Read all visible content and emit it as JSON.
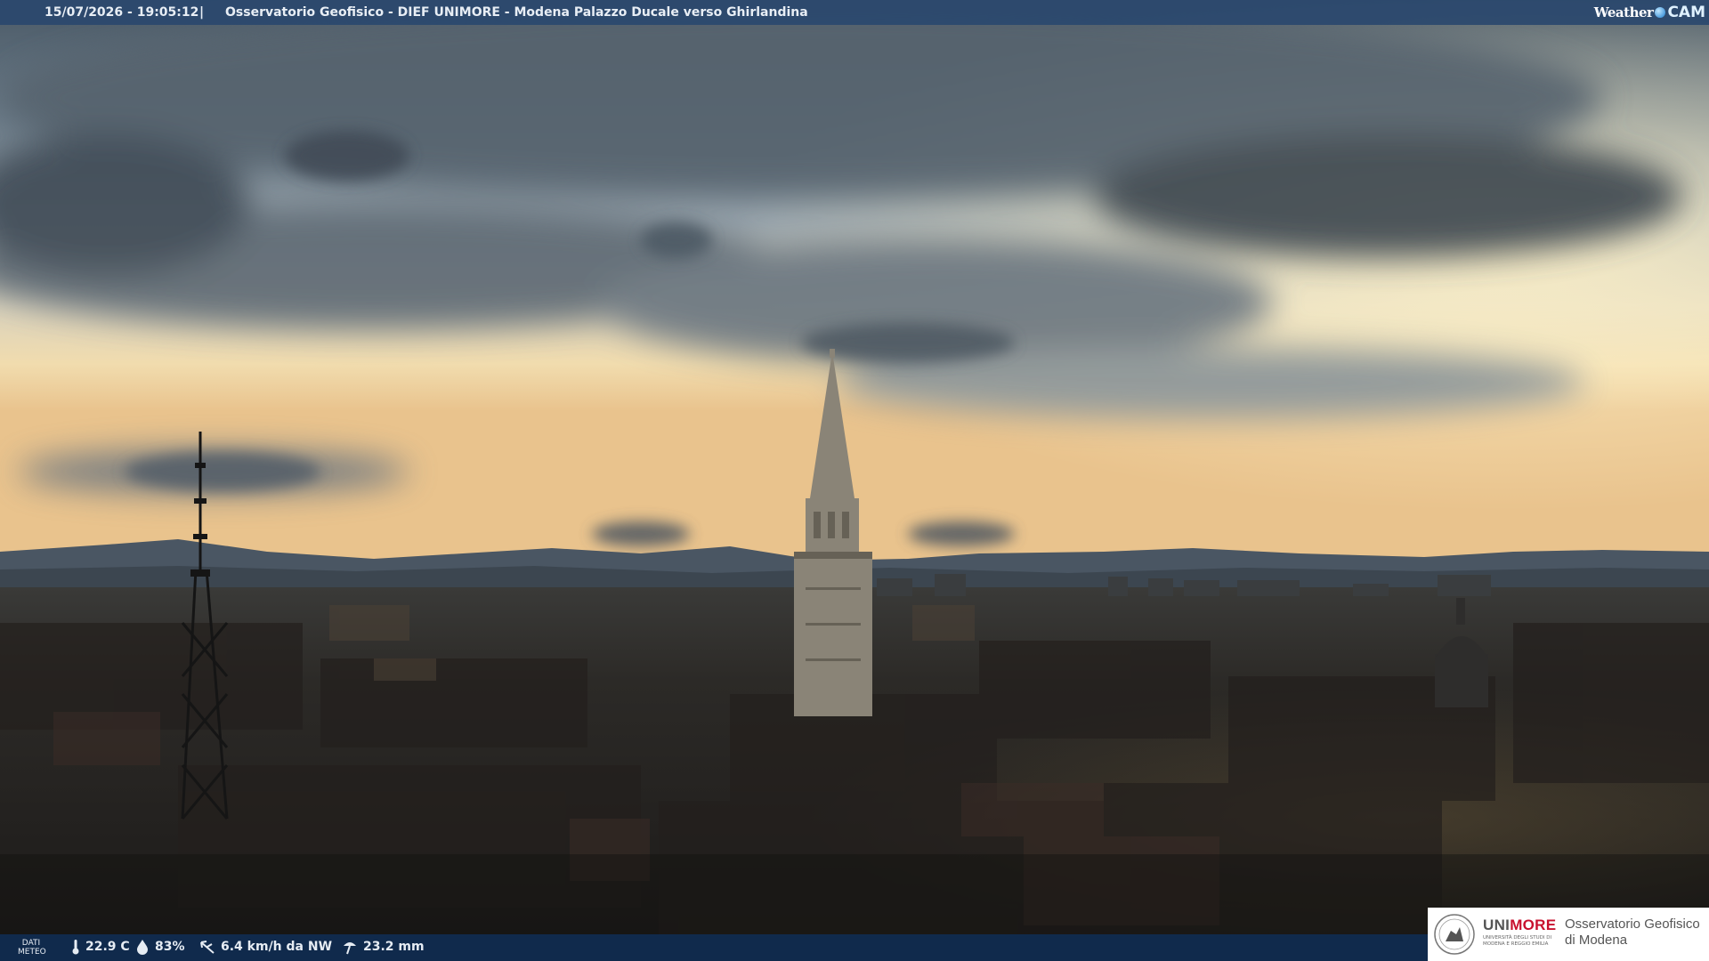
{
  "header": {
    "timestamp": "15/07/2026 - 19:05:12",
    "separator": "|",
    "title": "Osservatorio Geofisico - DIEF UNIMORE - Modena Palazzo Ducale verso Ghirlandina",
    "logo_left": "Weather",
    "logo_right": "CAM"
  },
  "weather": {
    "label": "DATI METEO",
    "temperature": "22.9 C",
    "humidity": "83%",
    "wind": "6.4 km/h da NW",
    "rain": "23.2 mm"
  },
  "branding": {
    "uni_a": "UNI",
    "uni_b": "MORE",
    "uni_sub": "UNIVERSITÀ DEGLI STUDI DI MODENA E REGGIO EMILIA",
    "obs_line1": "Osservatorio Geofisico",
    "obs_line2": "di Modena"
  },
  "icons": [
    "thermometer-icon",
    "droplet-icon",
    "wind-icon",
    "rain-gauge-icon",
    "weathercam-globe-icon"
  ]
}
